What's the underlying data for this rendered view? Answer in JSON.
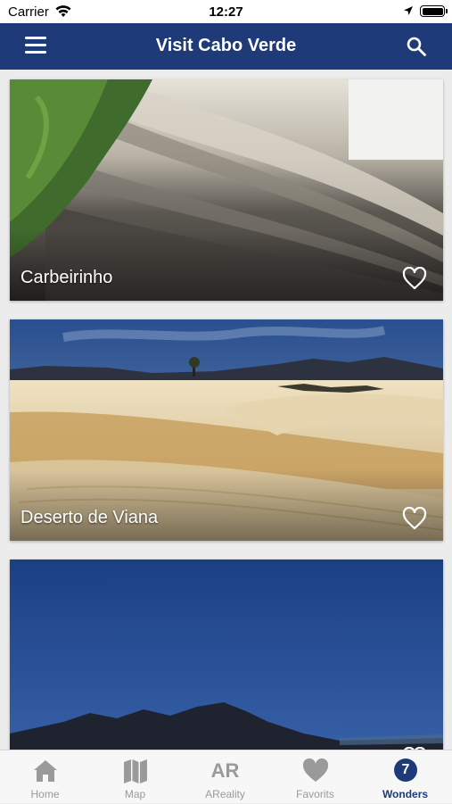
{
  "status_bar": {
    "carrier": "Carrier",
    "time": "12:27"
  },
  "nav": {
    "title": "Visit Cabo Verde",
    "menu_icon": "hamburger-menu-icon",
    "search_icon": "search-icon"
  },
  "cards": [
    {
      "name": "Carbeirinho",
      "favorite": false
    },
    {
      "name": "Deserto de Viana",
      "favorite": false
    },
    {
      "name": "",
      "favorite": false
    }
  ],
  "tabs": [
    {
      "label": "Home",
      "icon": "home-icon",
      "active": false
    },
    {
      "label": "Map",
      "icon": "map-icon",
      "active": false
    },
    {
      "label": "AReality",
      "icon_text": "AR",
      "active": false
    },
    {
      "label": "Favorits",
      "icon": "heart-icon",
      "active": false
    },
    {
      "label": "Wonders",
      "badge": "7",
      "active": true
    }
  ],
  "colors": {
    "primary": "#1e3a78",
    "tab_inactive": "#9a9a9a"
  }
}
